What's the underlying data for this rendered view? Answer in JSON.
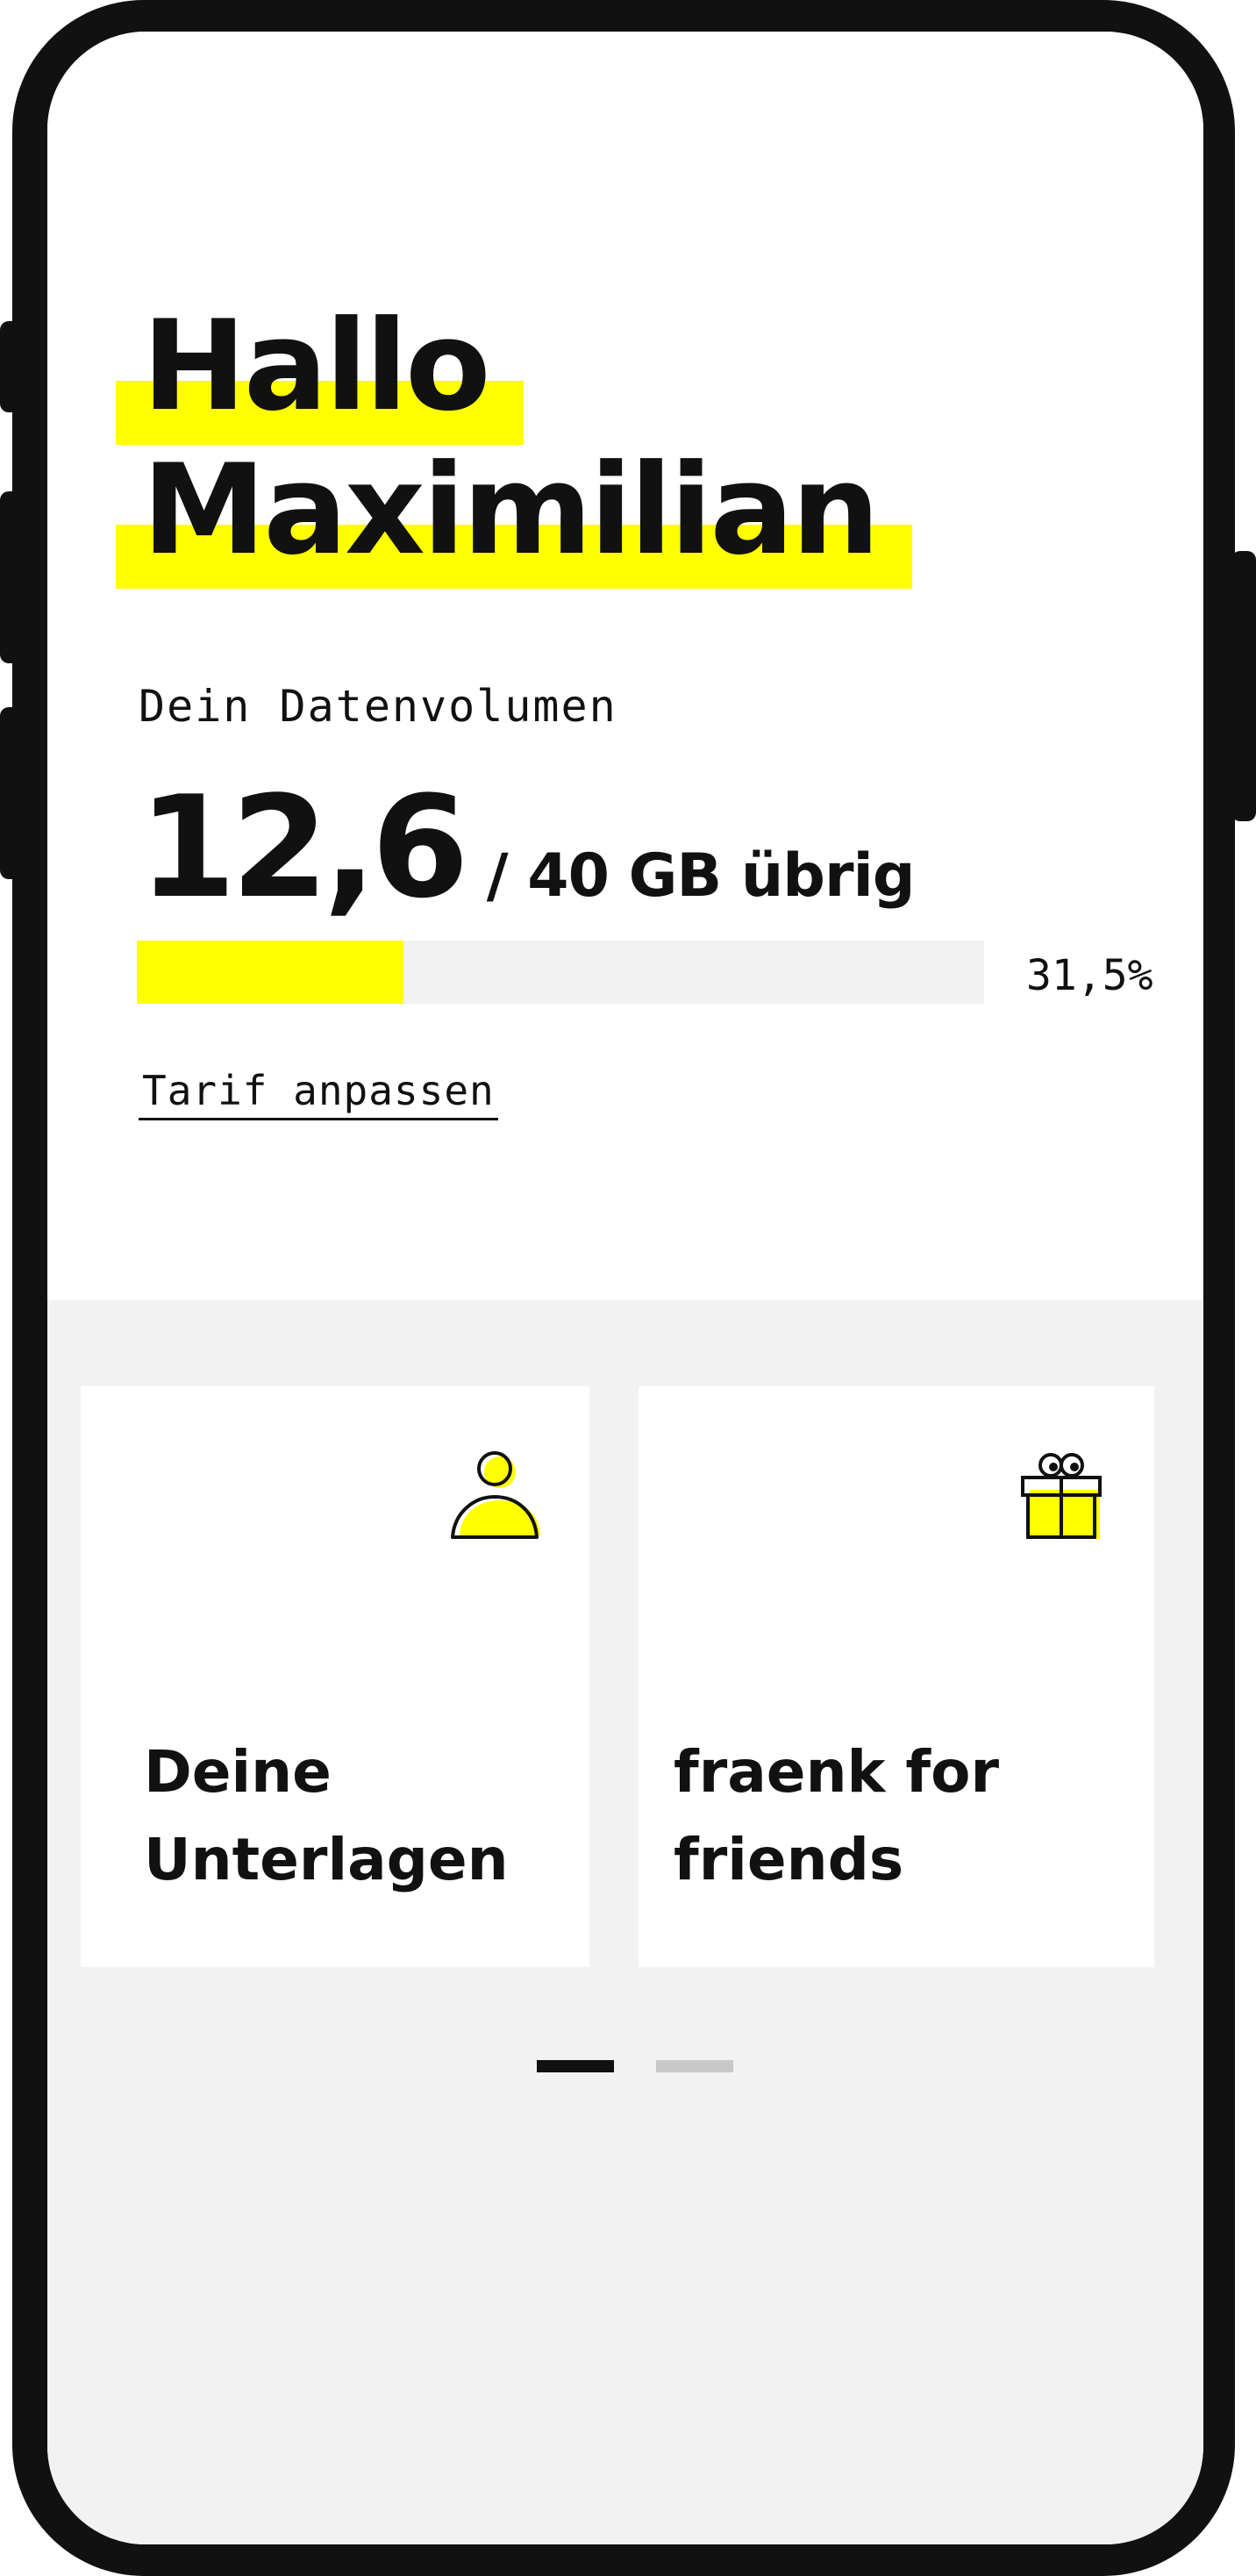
{
  "greeting": {
    "line1": "Hallo",
    "line2": "Maximilian"
  },
  "data_usage": {
    "label": "Dein Datenvolumen",
    "used": "12,6",
    "total_text": "/ 40 GB übrig",
    "percent_text": "31,5%",
    "percent_value": 31.5
  },
  "tarif_link": "Tarif anpassen",
  "cards": [
    {
      "title": "Deine Unterlagen",
      "icon": "person-icon"
    },
    {
      "title": "fraenk for friends",
      "icon": "gift-icon"
    }
  ],
  "pager": {
    "count": 2,
    "active": 1
  },
  "colors": {
    "accent": "#ffff00",
    "text": "#111111",
    "background_secondary": "#f2f2f2",
    "pager_inactive": "#c8c8c8"
  }
}
